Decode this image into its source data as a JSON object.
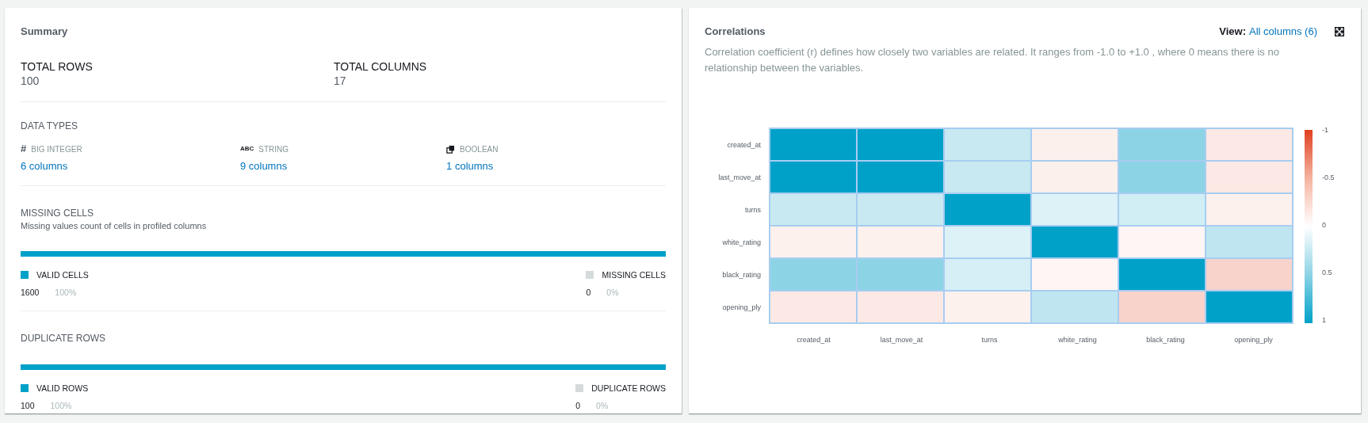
{
  "summary": {
    "title": "Summary",
    "totals": [
      {
        "label": "TOTAL ROWS",
        "value": "100"
      },
      {
        "label": "TOTAL COLUMNS",
        "value": "17"
      }
    ],
    "data_types": {
      "title": "DATA TYPES",
      "items": [
        {
          "kind": "integer",
          "icon_text": "#",
          "label": "BIG INTEGER",
          "link": "6 columns"
        },
        {
          "kind": "string",
          "icon_text": "ABC",
          "label": "STRING",
          "link": "9 columns"
        },
        {
          "kind": "boolean",
          "label": "BOOLEAN",
          "link": "1 columns"
        }
      ]
    },
    "sections": [
      {
        "title": "MISSING CELLS",
        "subtitle": "Missing values count of cells in profiled columns",
        "level": 1,
        "legend": [
          {
            "label": "VALID CELLS",
            "value": "1600",
            "percent": "100%",
            "color": "#00a1c9"
          },
          {
            "label": "MISSING CELLS",
            "value": "0",
            "percent": "0%",
            "color": "#d5dbdb"
          }
        ]
      },
      {
        "title": "DUPLICATE ROWS",
        "level": 1,
        "legend": [
          {
            "label": "VALID ROWS",
            "value": "100",
            "percent": "100%",
            "color": "#00a1c9"
          },
          {
            "label": "DUPLICATE ROWS",
            "value": "0",
            "percent": "0%",
            "color": "#d5dbdb"
          }
        ]
      }
    ]
  },
  "correlations": {
    "title": "Correlations",
    "view_label": "View:",
    "view_link": "All columns (6)",
    "description": "Correlation coefficient (r) defines how closely two variables are related. It ranges from -1.0 to +1.0 , where 0 means there is no relationship between the variables.",
    "heatmap": {
      "columns": [
        "created_at",
        "last_move_at",
        "turns",
        "white_rating",
        "black_rating",
        "opening_ply"
      ],
      "rows": [
        {
          "label": "created_at",
          "cells": [
            {
              "color": "#00a1c9"
            },
            {
              "color": "#00a1c9"
            },
            {
              "color": "#c8e9f2"
            },
            {
              "color": "#fcf0ed"
            },
            {
              "color": "#8dd3e6"
            },
            {
              "color": "#fce9e5"
            }
          ]
        },
        {
          "label": "last_move_at",
          "cells": [
            {
              "color": "#00a1c9"
            },
            {
              "color": "#00a1c9"
            },
            {
              "color": "#c8e9f2"
            },
            {
              "color": "#fcf0ed"
            },
            {
              "color": "#8dd3e6"
            },
            {
              "color": "#fce9e5"
            }
          ]
        },
        {
          "label": "turns",
          "cells": [
            {
              "color": "#c8e9f2"
            },
            {
              "color": "#c8e9f2"
            },
            {
              "color": "#00a1c9"
            },
            {
              "color": "#ddf2f7"
            },
            {
              "color": "#d2eef5"
            },
            {
              "color": "#fdf1ee"
            }
          ]
        },
        {
          "label": "white_rating",
          "cells": [
            {
              "color": "#fdf1ee"
            },
            {
              "color": "#fdf1ee"
            },
            {
              "color": "#ddf2f7"
            },
            {
              "color": "#00a1c9"
            },
            {
              "color": "#fef6f4"
            },
            {
              "color": "#bfe6f0"
            }
          ]
        },
        {
          "label": "black_rating",
          "cells": [
            {
              "color": "#8dd3e6"
            },
            {
              "color": "#8dd3e6"
            },
            {
              "color": "#d6eff6"
            },
            {
              "color": "#fef6f4"
            },
            {
              "color": "#00a1c9"
            },
            {
              "color": "#f7d3cb"
            }
          ]
        },
        {
          "label": "opening_ply",
          "cells": [
            {
              "color": "#fce9e5"
            },
            {
              "color": "#fce9e5"
            },
            {
              "color": "#fdf1ee"
            },
            {
              "color": "#bfe6f0"
            },
            {
              "color": "#f7d3cb"
            },
            {
              "color": "#00a1c9"
            }
          ]
        }
      ],
      "scale_labels": [
        "-1",
        "-0.5",
        "0",
        "0.5",
        "1"
      ]
    }
  }
}
